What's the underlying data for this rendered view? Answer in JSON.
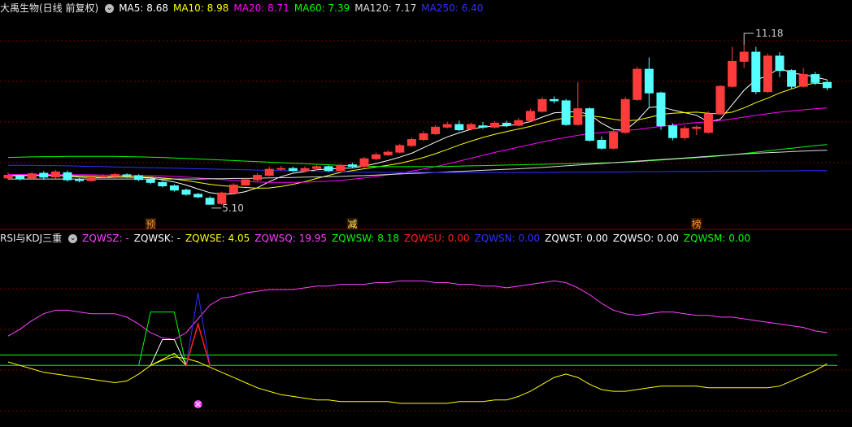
{
  "top": {
    "title": "大禹生物(日线 前复权)",
    "ma": [
      {
        "label": "MA5: 8.68",
        "color": "#ffffff"
      },
      {
        "label": "MA10: 8.98",
        "color": "#ffff00"
      },
      {
        "label": "MA20: 8.71",
        "color": "#ff00ff"
      },
      {
        "label": "MA60: 7.39",
        "color": "#00ff00"
      },
      {
        "label": "MA120: 7.17",
        "color": "#dddddd"
      },
      {
        "label": "MA250: 6.40",
        "color": "#3030ff"
      }
    ],
    "max_label": "11.18",
    "min_label": "5.10",
    "markers": [
      {
        "text": "预",
        "candle": 12
      },
      {
        "text": "减",
        "candle": 29
      },
      {
        "text": "榜",
        "candle": 58
      }
    ]
  },
  "bottom": {
    "title": "RSI与KDJ三重",
    "items": [
      {
        "label": "ZQWSZ: -",
        "color": "#ff40ff"
      },
      {
        "label": "ZQWSK: -",
        "color": "#ffffff"
      },
      {
        "label": "ZQWSE: 4.05",
        "color": "#ffff00"
      },
      {
        "label": "ZQWSQ: 19.95",
        "color": "#ff40ff"
      },
      {
        "label": "ZQWSW: 8.18",
        "color": "#00ff00"
      },
      {
        "label": "ZQWSU: 0.00",
        "color": "#ff2020"
      },
      {
        "label": "ZQWSN: 0.00",
        "color": "#3030ff"
      },
      {
        "label": "ZQWST: 0.00",
        "color": "#ffffff"
      },
      {
        "label": "ZQWSO: 0.00",
        "color": "#ffffff"
      },
      {
        "label": "ZQWSM: 0.00",
        "color": "#00ff00"
      }
    ]
  },
  "chart_data": {
    "type": "candlestick",
    "count": 70,
    "ylim": [
      4.6,
      12.2
    ],
    "candles": [
      [
        6.12,
        6.22,
        6.05,
        6.33
      ],
      [
        6.18,
        6.1,
        6.02,
        6.25
      ],
      [
        6.12,
        6.28,
        6.05,
        6.35
      ],
      [
        6.3,
        6.15,
        6.05,
        6.38
      ],
      [
        6.16,
        6.35,
        6.1,
        6.42
      ],
      [
        6.32,
        6.05,
        5.98,
        6.4
      ],
      [
        6.05,
        6.02,
        5.95,
        6.12
      ],
      [
        6.02,
        6.15,
        5.98,
        6.22
      ],
      [
        6.15,
        6.18,
        6.06,
        6.26
      ],
      [
        6.18,
        6.25,
        6.1,
        6.32
      ],
      [
        6.24,
        6.2,
        6.12,
        6.3
      ],
      [
        6.2,
        6.06,
        6.0,
        6.26
      ],
      [
        6.06,
        5.95,
        5.88,
        6.1
      ],
      [
        5.95,
        5.82,
        5.76,
        6.0
      ],
      [
        5.82,
        5.66,
        5.6,
        5.88
      ],
      [
        5.66,
        5.5,
        5.45,
        5.72
      ],
      [
        5.5,
        5.4,
        5.35,
        5.55
      ],
      [
        5.35,
        5.12,
        5.1,
        5.42
      ],
      [
        5.15,
        5.55,
        5.1,
        5.6
      ],
      [
        5.55,
        5.85,
        5.5,
        5.92
      ],
      [
        5.85,
        6.05,
        5.8,
        6.12
      ],
      [
        6.05,
        6.22,
        5.98,
        6.3
      ],
      [
        6.22,
        6.45,
        6.18,
        6.55
      ],
      [
        6.45,
        6.48,
        6.38,
        6.58
      ],
      [
        6.48,
        6.4,
        6.35,
        6.55
      ],
      [
        6.4,
        6.48,
        6.35,
        6.56
      ],
      [
        6.48,
        6.55,
        6.42,
        6.62
      ],
      [
        6.55,
        6.4,
        6.35,
        6.6
      ],
      [
        6.4,
        6.6,
        6.35,
        6.66
      ],
      [
        6.62,
        6.56,
        6.5,
        6.7
      ],
      [
        6.56,
        6.85,
        6.5,
        6.92
      ],
      [
        6.85,
        7.0,
        6.8,
        7.08
      ],
      [
        7.0,
        7.1,
        6.95,
        7.18
      ],
      [
        7.1,
        7.35,
        7.05,
        7.42
      ],
      [
        7.35,
        7.58,
        7.3,
        7.66
      ],
      [
        7.58,
        7.8,
        7.52,
        7.9
      ],
      [
        7.8,
        8.05,
        7.75,
        8.12
      ],
      [
        8.05,
        8.15,
        8.0,
        8.25
      ],
      [
        8.15,
        7.95,
        7.9,
        8.3
      ],
      [
        7.98,
        8.15,
        7.92,
        8.22
      ],
      [
        8.1,
        8.05,
        7.98,
        8.25
      ],
      [
        8.05,
        8.2,
        8.0,
        8.28
      ],
      [
        8.2,
        8.12,
        8.05,
        8.3
      ],
      [
        8.12,
        8.3,
        8.08,
        8.4
      ],
      [
        8.3,
        8.65,
        8.25,
        8.75
      ],
      [
        8.65,
        9.1,
        8.6,
        9.2
      ],
      [
        9.1,
        9.05,
        8.95,
        9.22
      ],
      [
        9.05,
        8.15,
        8.1,
        9.12
      ],
      [
        8.15,
        8.75,
        8.1,
        9.75
      ],
      [
        8.75,
        7.55,
        7.5,
        8.8
      ],
      [
        7.55,
        7.25,
        7.2,
        7.7
      ],
      [
        7.25,
        7.85,
        7.2,
        7.95
      ],
      [
        7.85,
        9.1,
        7.8,
        9.2
      ],
      [
        9.1,
        10.25,
        9.05,
        10.35
      ],
      [
        10.25,
        9.35,
        8.8,
        10.7
      ],
      [
        9.35,
        8.1,
        7.95,
        9.4
      ],
      [
        8.1,
        7.65,
        7.55,
        8.2
      ],
      [
        7.65,
        8.0,
        7.55,
        8.1
      ],
      [
        8.0,
        8.05,
        7.75,
        8.12
      ],
      [
        7.85,
        8.55,
        7.8,
        8.65
      ],
      [
        8.55,
        9.6,
        8.5,
        9.65
      ],
      [
        9.6,
        10.55,
        9.55,
        11.1
      ],
      [
        10.55,
        10.9,
        10.3,
        11.18
      ],
      [
        10.9,
        9.4,
        9.3,
        11.1
      ],
      [
        9.4,
        10.75,
        9.35,
        10.85
      ],
      [
        10.75,
        10.2,
        9.95,
        10.9
      ],
      [
        10.2,
        9.6,
        9.5,
        10.25
      ],
      [
        9.6,
        10.05,
        9.55,
        10.3
      ],
      [
        10.05,
        9.75,
        9.65,
        10.15
      ],
      [
        9.75,
        9.55,
        9.45,
        9.85
      ]
    ],
    "ma_series": [
      {
        "name": "MA5",
        "color": "#ffffff",
        "values": [
          6.2,
          6.21,
          6.21,
          6.22,
          6.22,
          6.19,
          6.15,
          6.13,
          6.13,
          6.15,
          6.15,
          6.14,
          6.12,
          6.05,
          5.97,
          5.85,
          5.7,
          5.56,
          5.5,
          5.52,
          5.6,
          5.75,
          5.98,
          6.17,
          6.3,
          6.36,
          6.43,
          6.46,
          6.48,
          6.5,
          6.57,
          6.67,
          6.78,
          6.91,
          7.06,
          7.27,
          7.48,
          7.68,
          7.83,
          7.97,
          8.05,
          8.1,
          8.1,
          8.16,
          8.26,
          8.43,
          8.59,
          8.62,
          8.64,
          8.53,
          8.2,
          7.96,
          7.93,
          8.3,
          8.8,
          8.83,
          8.7,
          8.6,
          8.5,
          8.25,
          8.35,
          8.9,
          9.45,
          9.85,
          10.0,
          10.3,
          10.1,
          10.05,
          9.95,
          9.85
        ]
      },
      {
        "name": "MA10",
        "color": "#ffff00",
        "values": [
          6.22,
          6.22,
          6.22,
          6.22,
          6.21,
          6.21,
          6.2,
          6.19,
          6.18,
          6.17,
          6.17,
          6.16,
          6.15,
          6.12,
          6.08,
          6.02,
          5.95,
          5.88,
          5.83,
          5.79,
          5.76,
          5.73,
          5.74,
          5.8,
          5.88,
          5.98,
          6.1,
          6.22,
          6.33,
          6.4,
          6.47,
          6.54,
          6.6,
          6.68,
          6.78,
          6.9,
          7.04,
          7.2,
          7.37,
          7.52,
          7.66,
          7.78,
          7.88,
          7.98,
          8.08,
          8.2,
          8.32,
          8.41,
          8.48,
          8.48,
          8.43,
          8.35,
          8.29,
          8.32,
          8.42,
          8.53,
          8.58,
          8.6,
          8.62,
          8.58,
          8.55,
          8.62,
          8.78,
          8.98,
          9.15,
          9.35,
          9.5,
          9.65,
          9.72,
          9.7
        ]
      },
      {
        "name": "MA20",
        "color": "#ff00ff",
        "values": [
          6.25,
          6.25,
          6.25,
          6.25,
          6.25,
          6.24,
          6.24,
          6.24,
          6.23,
          6.23,
          6.22,
          6.22,
          6.21,
          6.2,
          6.18,
          6.15,
          6.12,
          6.09,
          6.06,
          6.03,
          6.0,
          5.97,
          5.95,
          5.95,
          5.95,
          5.96,
          5.98,
          6.0,
          6.03,
          6.07,
          6.12,
          6.18,
          6.24,
          6.3,
          6.38,
          6.46,
          6.55,
          6.65,
          6.76,
          6.87,
          6.98,
          7.09,
          7.19,
          7.29,
          7.39,
          7.49,
          7.58,
          7.66,
          7.74,
          7.8,
          7.85,
          7.89,
          7.92,
          7.96,
          8.02,
          8.08,
          8.13,
          8.18,
          8.22,
          8.26,
          8.3,
          8.36,
          8.43,
          8.5,
          8.56,
          8.62,
          8.67,
          8.71,
          8.75,
          8.78
        ]
      },
      {
        "name": "MA60",
        "color": "#00ff00",
        "values": [
          6.9,
          6.91,
          6.92,
          6.93,
          6.93,
          6.94,
          6.94,
          6.94,
          6.94,
          6.94,
          6.93,
          6.92,
          6.91,
          6.9,
          6.88,
          6.86,
          6.84,
          6.82,
          6.8,
          6.78,
          6.76,
          6.74,
          6.72,
          6.7,
          6.68,
          6.66,
          6.64,
          6.62,
          6.6,
          6.58,
          6.57,
          6.56,
          6.55,
          6.55,
          6.55,
          6.55,
          6.55,
          6.56,
          6.57,
          6.58,
          6.59,
          6.6,
          6.61,
          6.62,
          6.63,
          6.64,
          6.65,
          6.66,
          6.67,
          6.68,
          6.69,
          6.7,
          6.72,
          6.74,
          6.77,
          6.8,
          6.83,
          6.86,
          6.89,
          6.92,
          6.96,
          7.0,
          7.05,
          7.1,
          7.15,
          7.2,
          7.25,
          7.3,
          7.35,
          7.39
        ]
      },
      {
        "name": "MA120",
        "color": "#dddddd",
        "values": [
          6.08,
          6.08,
          6.08,
          6.08,
          6.08,
          6.08,
          6.08,
          6.08,
          6.08,
          6.08,
          6.08,
          6.08,
          6.08,
          6.08,
          6.08,
          6.08,
          6.08,
          6.09,
          6.09,
          6.1,
          6.1,
          6.11,
          6.12,
          6.13,
          6.14,
          6.15,
          6.16,
          6.17,
          6.18,
          6.2,
          6.21,
          6.23,
          6.25,
          6.27,
          6.29,
          6.31,
          6.33,
          6.35,
          6.37,
          6.39,
          6.41,
          6.43,
          6.45,
          6.47,
          6.49,
          6.52,
          6.55,
          6.58,
          6.61,
          6.64,
          6.67,
          6.7,
          6.73,
          6.76,
          6.79,
          6.82,
          6.85,
          6.88,
          6.91,
          6.94,
          6.97,
          7.0,
          7.03,
          7.06,
          7.08,
          7.1,
          7.12,
          7.14,
          7.16,
          7.17
        ]
      },
      {
        "name": "MA250",
        "color": "#3030ff",
        "values": [
          6.6,
          6.6,
          6.6,
          6.59,
          6.59,
          6.58,
          6.57,
          6.56,
          6.55,
          6.54,
          6.53,
          6.52,
          6.51,
          6.5,
          6.49,
          6.48,
          6.47,
          6.46,
          6.45,
          6.44,
          6.43,
          6.42,
          6.41,
          6.4,
          6.39,
          6.38,
          6.37,
          6.36,
          6.35,
          6.35,
          6.34,
          6.34,
          6.33,
          6.33,
          6.33,
          6.33,
          6.33,
          6.33,
          6.33,
          6.33,
          6.33,
          6.33,
          6.33,
          6.33,
          6.33,
          6.33,
          6.33,
          6.34,
          6.34,
          6.34,
          6.35,
          6.35,
          6.35,
          6.36,
          6.36,
          6.36,
          6.37,
          6.37,
          6.37,
          6.37,
          6.38,
          6.38,
          6.38,
          6.38,
          6.39,
          6.39,
          6.39,
          6.4,
          6.4,
          6.4
        ]
      }
    ],
    "indicator": {
      "ylim": [
        0,
        100
      ],
      "magenta": [
        48,
        52,
        57,
        61,
        63,
        63,
        62,
        61,
        61,
        61,
        59,
        55,
        50,
        47,
        46,
        50,
        58,
        66,
        70,
        71,
        73,
        74,
        75,
        75,
        75,
        76,
        77,
        77,
        78,
        78,
        78,
        79,
        79,
        80,
        80,
        80,
        79,
        79,
        78,
        78,
        77,
        77,
        76,
        77,
        78,
        79,
        80,
        79,
        76,
        72,
        67,
        63,
        61,
        60,
        61,
        62,
        62,
        61,
        60,
        60,
        59,
        59,
        58,
        57,
        56,
        55,
        54,
        53,
        51,
        50
      ],
      "yellow": [
        33,
        31,
        29,
        27,
        26,
        25,
        24,
        23,
        22,
        21,
        22,
        26,
        31,
        34,
        36,
        35,
        33,
        30,
        27,
        24,
        21,
        18,
        16,
        14,
        13,
        12,
        11,
        11,
        10,
        10,
        10,
        10,
        10,
        9,
        9,
        9,
        9,
        9,
        10,
        10,
        10,
        11,
        11,
        13,
        16,
        20,
        24,
        26,
        24,
        20,
        17,
        16,
        16,
        17,
        18,
        19,
        19,
        19,
        19,
        18,
        18,
        18,
        18,
        18,
        18,
        19,
        22,
        25,
        28,
        32
      ],
      "flat_green": [
        37,
        31
      ],
      "green_spike": [
        [
          11,
          31
        ],
        [
          12,
          62
        ],
        [
          13,
          62
        ],
        [
          14,
          62
        ],
        [
          15,
          31
        ]
      ],
      "white_spike": [
        [
          12,
          31
        ],
        [
          13,
          46
        ],
        [
          14,
          46
        ],
        [
          15,
          31
        ]
      ],
      "yellow_spike": [
        [
          12,
          31
        ],
        [
          14,
          38
        ],
        [
          15,
          31
        ]
      ],
      "red_blue_spike": [
        [
          15,
          31
        ],
        [
          16,
          73
        ],
        [
          17,
          31
        ]
      ],
      "cross_marker": 16
    }
  }
}
